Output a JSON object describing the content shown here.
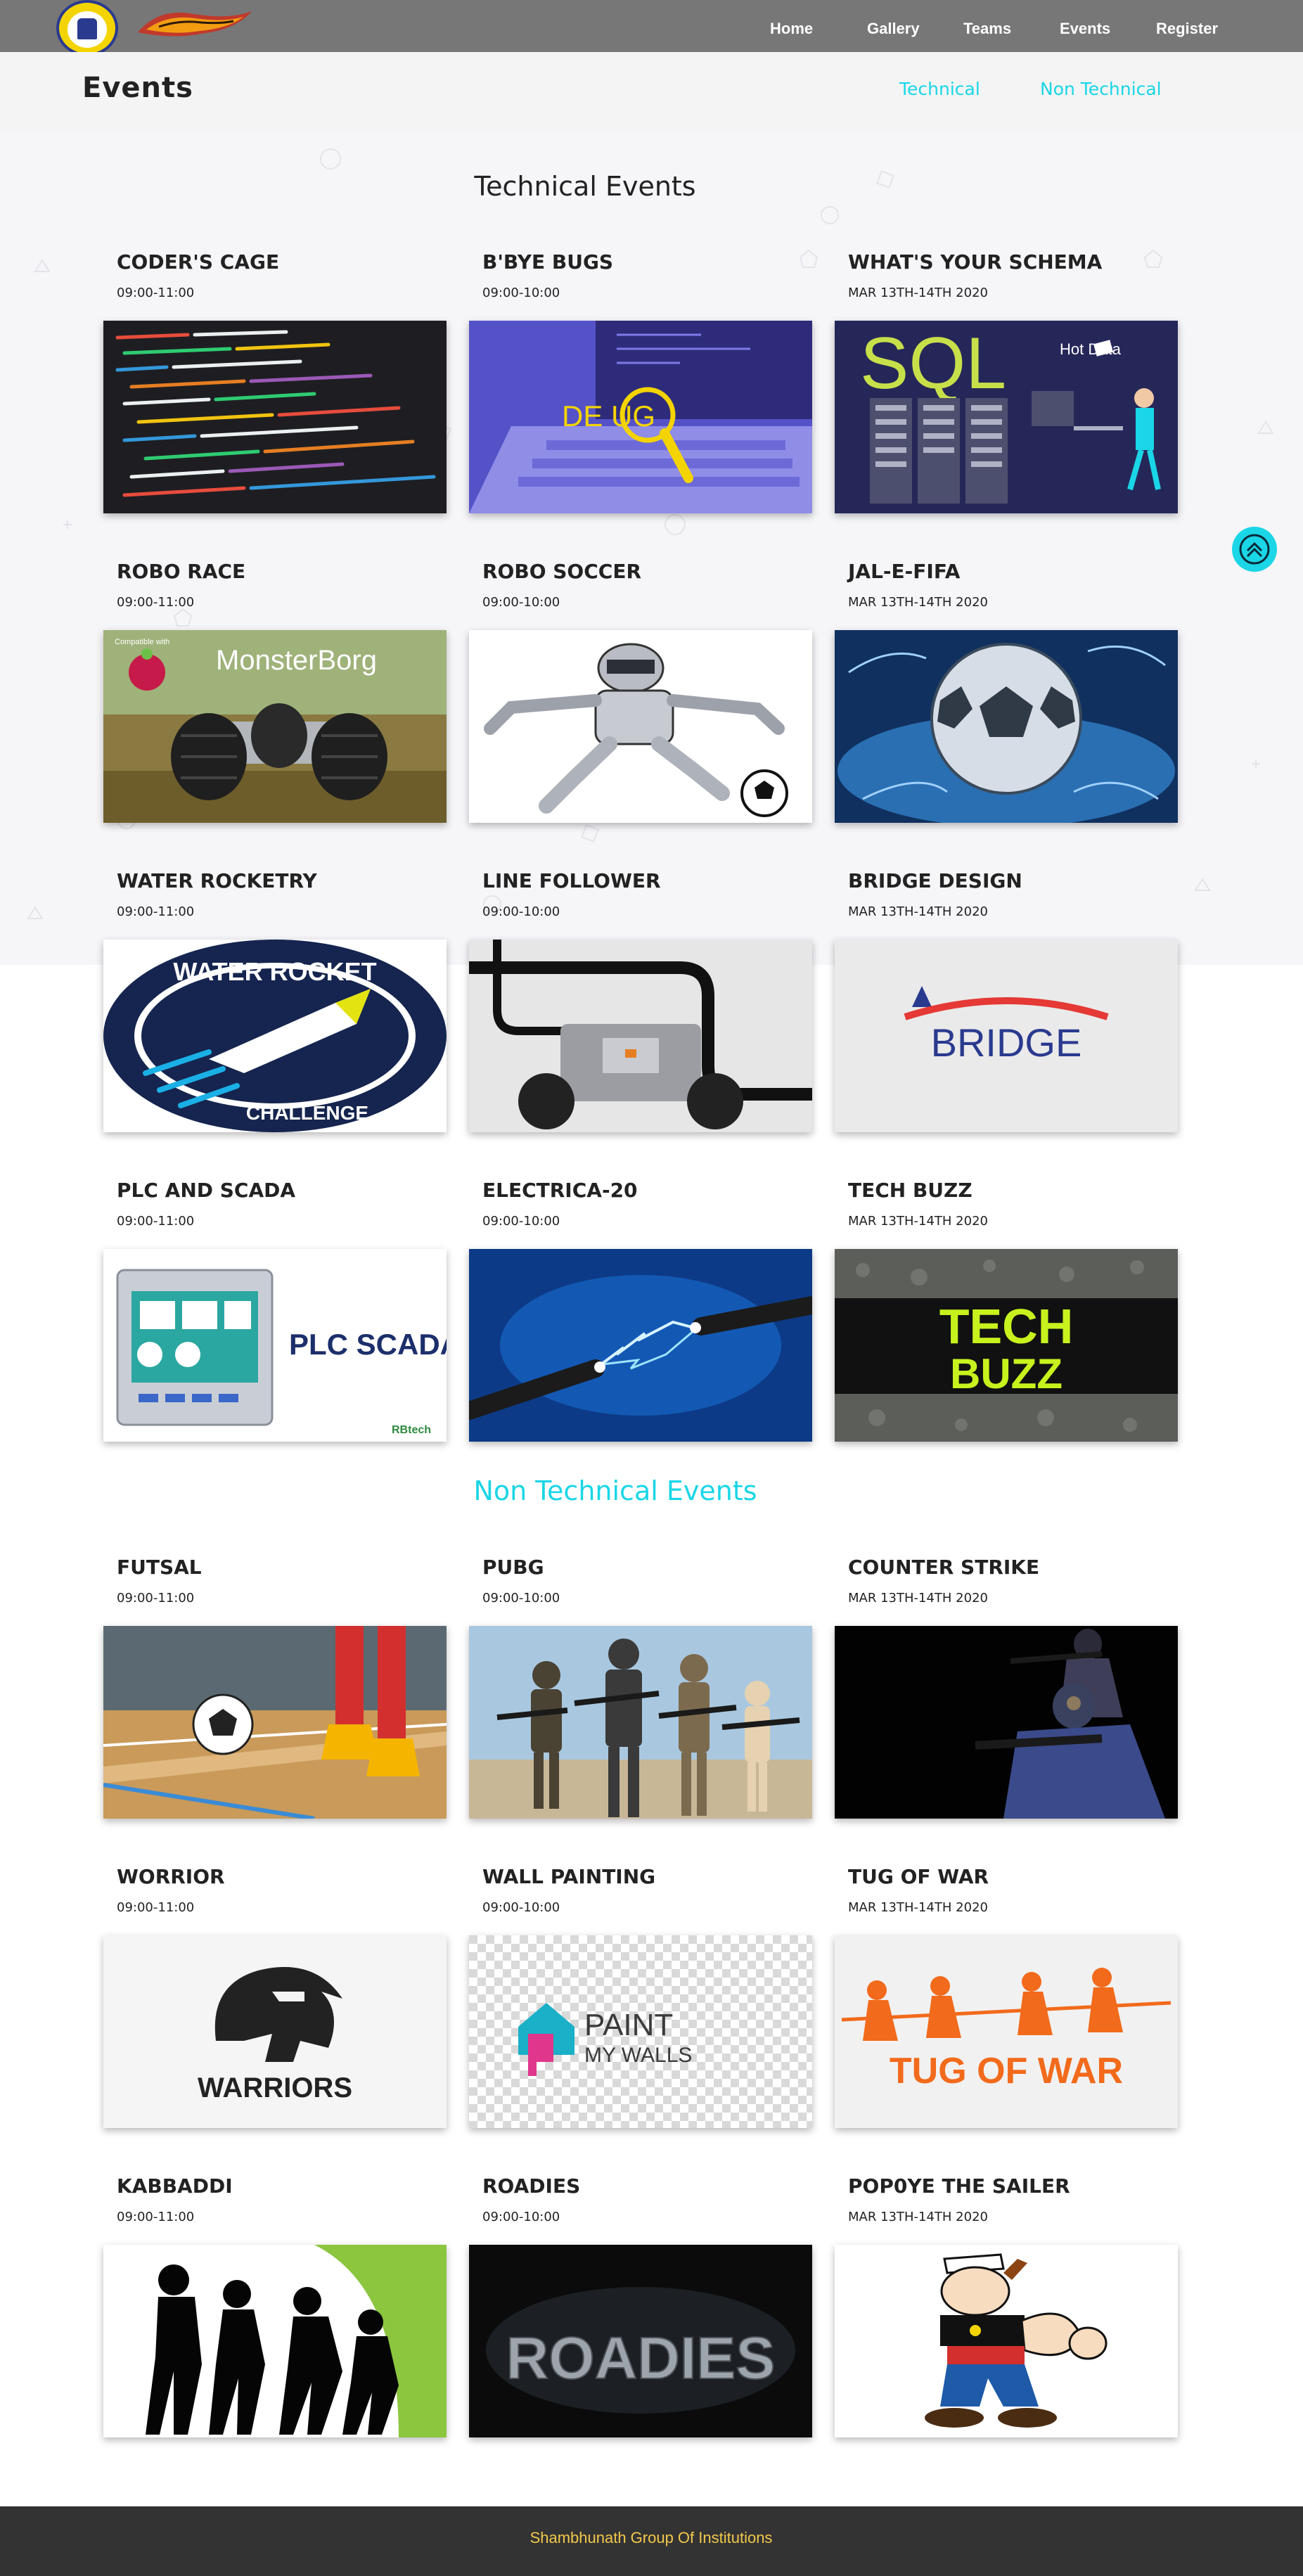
{
  "nav": {
    "links": [
      {
        "id": "home",
        "label": "Home"
      },
      {
        "id": "gallery",
        "label": "Gallery"
      },
      {
        "id": "teams",
        "label": "Teams"
      },
      {
        "id": "events",
        "label": "Events"
      },
      {
        "id": "register",
        "label": "Register"
      }
    ]
  },
  "subheader": {
    "title": "Events",
    "technical_link": "Technical",
    "non_technical_link": "Non Technical"
  },
  "technical": {
    "heading": "Technical Events",
    "events": [
      {
        "title": "CODER'S CAGE",
        "time": "09:00-11:00",
        "image": "code-screen"
      },
      {
        "title": "B'BYE BUGS",
        "time": "09:00-10:00",
        "image": "debug-laptop",
        "image_text": "DE  UG"
      },
      {
        "title": "WHAT'S YOUR SCHEMA",
        "time": "MAR 13TH-14TH 2020",
        "image": "sql-servers",
        "image_text": "SQL",
        "image_subtext": "Hot Data"
      },
      {
        "title": "ROBO RACE",
        "time": "09:00-11:00",
        "image": "rover",
        "image_text": "MonsterBorg",
        "image_subtext": "Compatible with"
      },
      {
        "title": "ROBO SOCCER",
        "time": "09:00-10:00",
        "image": "robot"
      },
      {
        "title": "JAL-E-FIFA",
        "time": "MAR 13TH-14TH 2020",
        "image": "water-ball"
      },
      {
        "title": "WATER ROCKETRY",
        "time": "09:00-11:00",
        "image": "rocket-badge",
        "image_text": "WATER ROCKET",
        "image_subtext": "CHALLENGE"
      },
      {
        "title": "LINE FOLLOWER",
        "time": "09:00-10:00",
        "image": "line-robot"
      },
      {
        "title": "BRIDGE DESIGN",
        "time": "MAR 13TH-14TH 2020",
        "image": "bridge-logo",
        "image_text": "BRIDGE"
      },
      {
        "title": "PLC AND SCADA",
        "time": "09:00-11:00",
        "image": "plc-panel",
        "image_text": "PLC SCADA",
        "image_subtext": "RBtech"
      },
      {
        "title": "ELECTRICA-20",
        "time": "09:00-10:00",
        "image": "spark-wires"
      },
      {
        "title": "TECH BUZZ",
        "time": "MAR 13TH-14TH 2020",
        "image": "tech-buzz",
        "image_text": "TECH",
        "image_subtext": "BUZZ"
      }
    ]
  },
  "non_technical": {
    "heading": "Non Technical Events",
    "events": [
      {
        "title": "FUTSAL",
        "time": "09:00-11:00",
        "image": "futsal"
      },
      {
        "title": "PUBG",
        "time": "09:00-10:00",
        "image": "pubg"
      },
      {
        "title": "COUNTER STRIKE",
        "time": "MAR 13TH-14TH 2020",
        "image": "soldier"
      },
      {
        "title": "WORRIOR",
        "time": "09:00-11:00",
        "image": "spartan",
        "image_text": "WARRIORS"
      },
      {
        "title": "WALL PAINTING",
        "time": "09:00-10:00",
        "image": "paint-walls",
        "image_text": "PAINT",
        "image_subtext": "MY WALLS"
      },
      {
        "title": "TUG OF WAR",
        "time": "MAR 13TH-14TH 2020",
        "image": "tug-of-war",
        "image_text": "TUG OF WAR"
      },
      {
        "title": "KABBADDI",
        "time": "09:00-11:00",
        "image": "kabaddi"
      },
      {
        "title": "ROADIES",
        "time": "09:00-10:00",
        "image": "roadies",
        "image_text": "ROADIES"
      },
      {
        "title": "POP0YE THE SAILER",
        "time": "MAR 13TH-14TH 2020",
        "image": "popeye"
      }
    ]
  },
  "footer": {
    "text": "Shambhunath Group Of Institutions"
  },
  "colors": {
    "accent": "#1ad6e6",
    "navbar": "#777777",
    "footer_bg": "#333333",
    "footer_text": "#f2c84b"
  }
}
